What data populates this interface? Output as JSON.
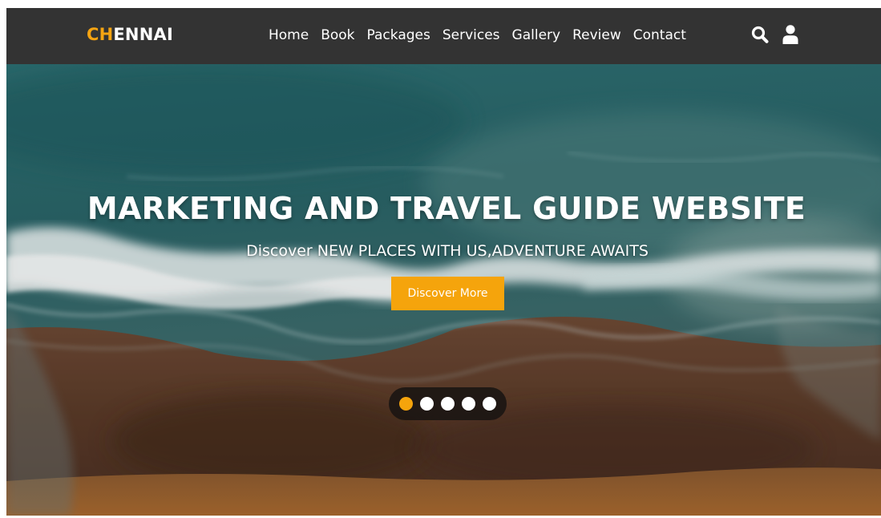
{
  "navbar": {
    "logo_accent": "CH",
    "logo_rest": "ENNAI",
    "links": [
      "Home",
      "Book",
      "Packages",
      "Services",
      "Gallery",
      "Review",
      "Contact"
    ],
    "icons": [
      "search-icon",
      "user-icon"
    ]
  },
  "hero": {
    "title": "MARKETING AND TRAVEL GUIDE WEBSITE",
    "subtitle": "Discover NEW PLACES WITH US,ADVENTURE AWAITS",
    "button_label": "Discover More",
    "slides_total": 5,
    "active_slide": 1
  },
  "colors": {
    "navbar_bg": "#333333",
    "accent": "#f5a40c",
    "text": "#ffffff"
  }
}
